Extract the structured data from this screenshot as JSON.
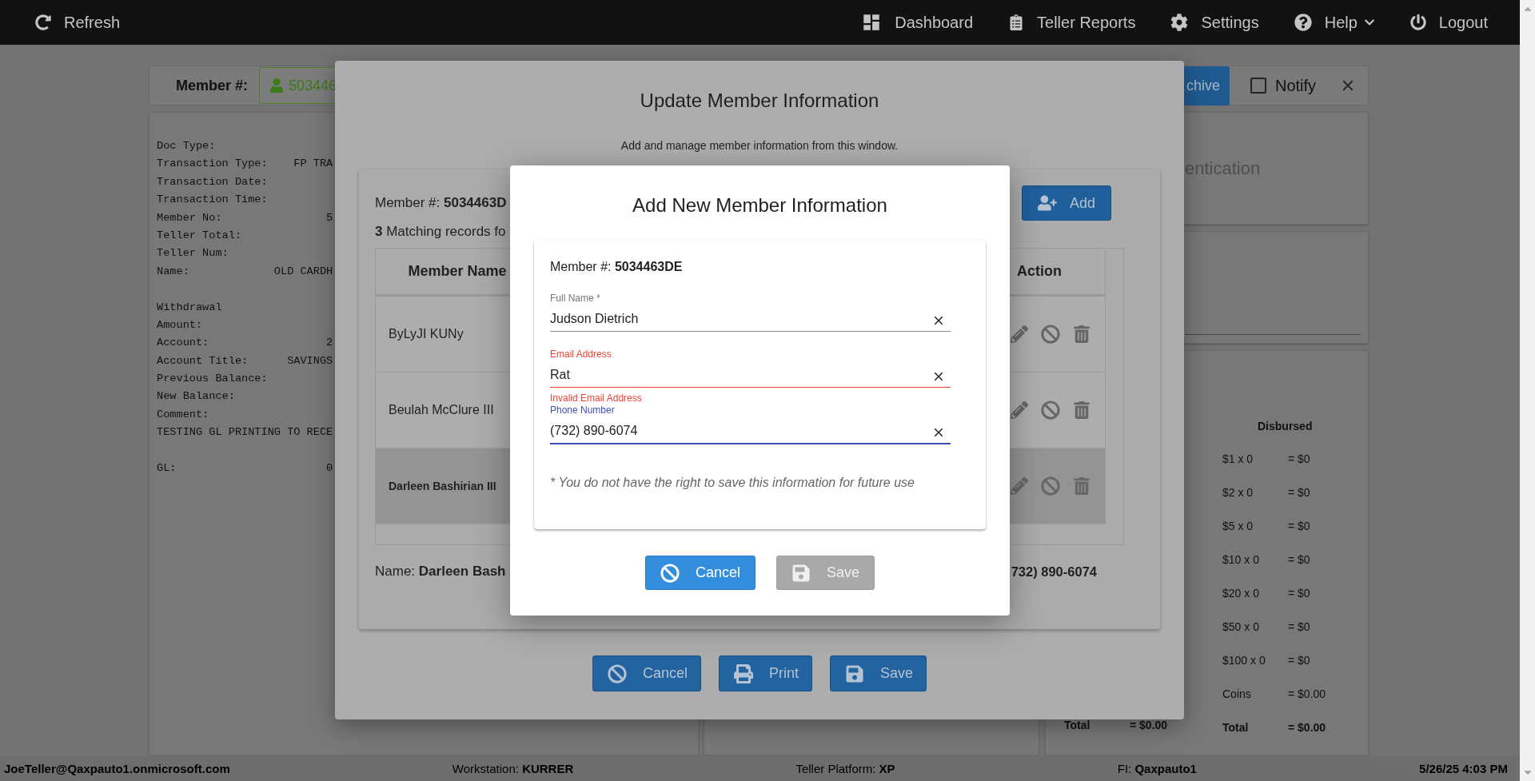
{
  "nav": {
    "left": [
      {
        "label": "Refresh"
      }
    ],
    "right": [
      {
        "label": "Dashboard",
        "dropdown": false
      },
      {
        "label": "Teller Reports",
        "dropdown": false
      },
      {
        "label": "Settings",
        "dropdown": false
      },
      {
        "label": "Help",
        "dropdown": true
      },
      {
        "label": "Logout",
        "dropdown": false
      }
    ]
  },
  "member_bar": {
    "label": "Member #:",
    "value": "503446",
    "archive_button": "chive",
    "notify": {
      "label": "Notify",
      "checked": false
    }
  },
  "receipt": {
    "groups": [
      [
        "Doc Type:",
        "Transaction Type:    FP TRA",
        "Transaction Date:",
        "Transaction Time:",
        "Member No:                5",
        "Teller Total:",
        "Teller Num:",
        "Name:             OLD CARDH"
      ],
      [
        "Withdrawal",
        "Amount:",
        "Account:                  2",
        "Account Title:      SAVINGS",
        "Previous Balance:",
        "New Balance:",
        "Comment:",
        "TESTING GL PRINTING TO RECE"
      ],
      [
        "GL:                       0"
      ]
    ]
  },
  "auth_panel": {
    "title": "entication"
  },
  "cash_tables": {
    "left_total": {
      "label": "Total",
      "value": "= $0.00"
    },
    "disbursed": {
      "title": "Disbursed",
      "rows": [
        {
          "label": "$1 x 0",
          "value": "= $0"
        },
        {
          "label": "$2 x 0",
          "value": "= $0"
        },
        {
          "label": "$5 x 0",
          "value": "= $0"
        },
        {
          "label": "$10 x 0",
          "value": "= $0"
        },
        {
          "label": "$20 x 0",
          "value": "= $0"
        },
        {
          "label": "$50 x 0",
          "value": "= $0"
        },
        {
          "label": "$100 x 0",
          "value": "= $0"
        },
        {
          "label": "Coins",
          "value": "= $0.00"
        }
      ],
      "total": {
        "label": "Total",
        "value": "= $0.00"
      }
    }
  },
  "update_dialog": {
    "title": "Update Member Information",
    "subtitle": "Add and manage member information from this window.",
    "member_label": "Member #:",
    "member_number": "5034463D",
    "match_count": "3",
    "match_text": "Matching records fo",
    "add_button": "Add",
    "table": {
      "columns": [
        "Member Name",
        "Action"
      ],
      "rows": [
        {
          "name": "ByLyJI KUNy",
          "selected": false
        },
        {
          "name": "Beulah McClure III",
          "selected": false
        },
        {
          "name": "Darleen Bashirian III",
          "selected": true
        }
      ]
    },
    "name_label": "Name:",
    "name_value": "Darleen Bash",
    "phone_value": "732) 890-6074",
    "buttons": [
      {
        "label": "Cancel"
      },
      {
        "label": "Print"
      },
      {
        "label": "Save"
      }
    ]
  },
  "add_dialog": {
    "title": "Add New Member Information",
    "member_label": "Member #:",
    "member_number": "5034463DE",
    "fields": [
      {
        "label": "Full Name *",
        "value": "Judson Dietrich",
        "invalid": false,
        "focused": false
      },
      {
        "label": "Email Address",
        "value": "Rat",
        "invalid": true,
        "focused": false,
        "error": "Invalid Email Address"
      },
      {
        "label": "Phone Number",
        "value": "(732) 890-6074",
        "invalid": false,
        "focused": true
      }
    ],
    "note": "* You do not have the right to save this information for future use",
    "buttons": [
      {
        "label": "Cancel",
        "disabled": false
      },
      {
        "label": "Save",
        "disabled": true
      }
    ]
  },
  "status_bar": [
    {
      "value": "JoeTeller@Qaxpauto1.onmicrosoft.com"
    },
    {
      "label": "Workstation:",
      "value": "KURRER"
    },
    {
      "label": "Teller Platform:",
      "value": "XP"
    },
    {
      "label": "FI:",
      "value": "Qaxpauto1"
    },
    {
      "value": "5/26/25 4:03 PM"
    }
  ]
}
